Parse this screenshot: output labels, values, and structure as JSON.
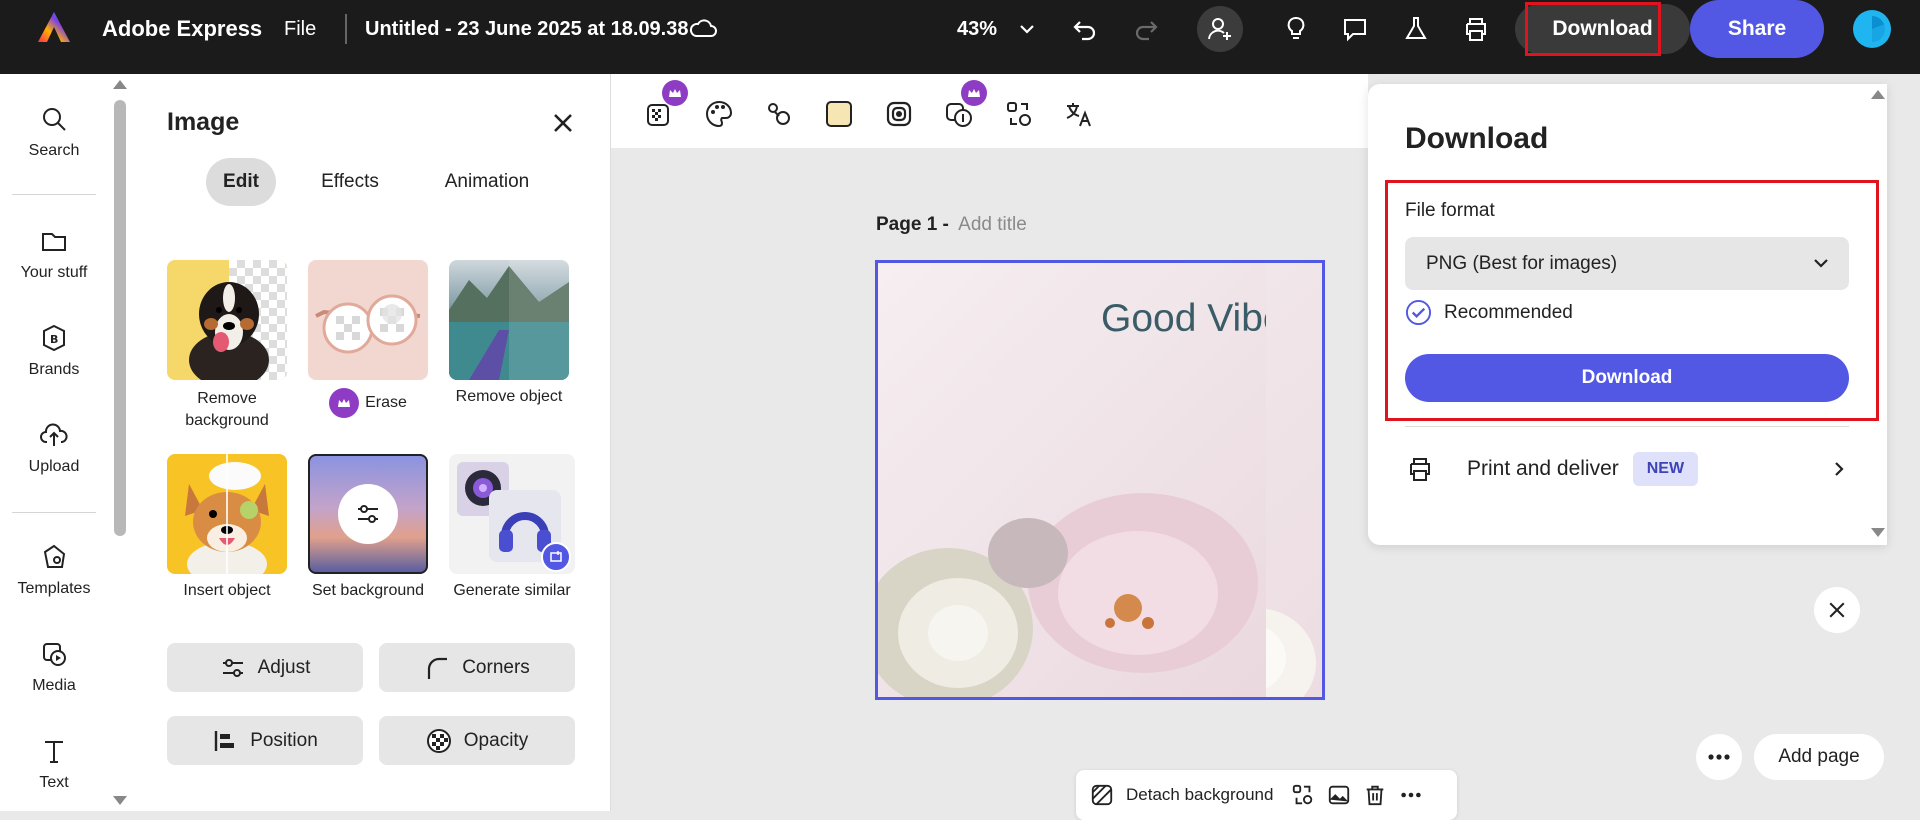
{
  "topbar": {
    "app_name": "Adobe Express",
    "file_menu": "File",
    "doc_title": "Untitled - 23 June 2025 at 18.09.38",
    "zoom": "43%",
    "download_label": "Download",
    "share_label": "Share"
  },
  "sidenav": {
    "items": [
      {
        "label": "Search",
        "icon": "search-icon"
      },
      {
        "label": "Your stuff",
        "icon": "folder-icon"
      },
      {
        "label": "Brands",
        "icon": "brand-icon"
      },
      {
        "label": "Upload",
        "icon": "upload-icon"
      },
      {
        "label": "Templates",
        "icon": "templates-icon"
      },
      {
        "label": "Media",
        "icon": "media-icon"
      },
      {
        "label": "Text",
        "icon": "text-icon"
      }
    ]
  },
  "panel": {
    "title": "Image",
    "tabs": [
      "Edit",
      "Effects",
      "Animation"
    ],
    "active_tab": "Edit",
    "tiles": [
      "Remove background",
      "Erase",
      "Remove object",
      "Insert object",
      "Set background",
      "Generate similar"
    ],
    "buttons": [
      "Adjust",
      "Corners",
      "Position",
      "Opacity"
    ]
  },
  "canvas": {
    "page_label": "Page 1 - ",
    "page_title_placeholder": "Add title",
    "headline": "Good Vibes Only",
    "add_page": "Add page",
    "bottom_bar": {
      "detach_label": "Detach background"
    }
  },
  "download_panel": {
    "title": "Download",
    "file_format_label": "File format",
    "selected_format": "PNG (Best for images)",
    "recommended": "Recommended",
    "download_button": "Download",
    "print_label": "Print and deliver",
    "new_badge": "NEW"
  },
  "colors": {
    "accent": "#5258e4",
    "topbar": "#1b1b1b",
    "highlight": "#e0141e",
    "premium": "#8e3cc4"
  }
}
